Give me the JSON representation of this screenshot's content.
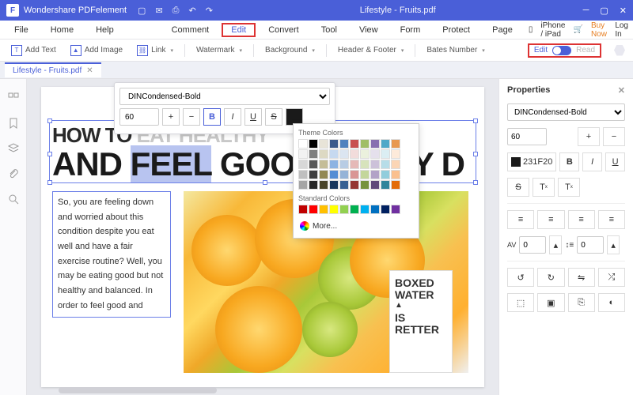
{
  "titlebar": {
    "app": "Wondershare PDFelement",
    "document": "Lifestyle - Fruits.pdf"
  },
  "menus": {
    "file": "File",
    "home": "Home",
    "help": "Help",
    "comment": "Comment",
    "edit": "Edit",
    "convert": "Convert",
    "tool": "Tool",
    "view": "View",
    "form": "Form",
    "protect": "Protect",
    "page": "Page",
    "iphone": "iPhone / iPad",
    "buy": "Buy Now",
    "login": "Log In"
  },
  "toolbar": {
    "addText": "Add Text",
    "addImage": "Add Image",
    "link": "Link",
    "watermark": "Watermark",
    "background": "Background",
    "headerFooter": "Header & Footer",
    "bates": "Bates Number",
    "edit": "Edit",
    "read": "Read"
  },
  "tab": {
    "name": "Lifestyle - Fruits.pdf"
  },
  "float": {
    "font": "DINCondensed-Bold",
    "size": "60"
  },
  "colorpop": {
    "theme": "Theme Colors",
    "standard": "Standard Colors",
    "more": "More..."
  },
  "doc": {
    "hl1a": "HOW TO ",
    "hl1b": "EAT HEALTHY",
    "hl2a": "AND ",
    "hl2b": "FEEL",
    "hl2c": " GOOD ",
    "hl2d": "RY D",
    "body": "So, you are feeling down and worried about this condition despite you eat well and have a fair exercise routine? Well, you may be eating good but not healthy and balanced.\nIn order to feel good and",
    "carton1": "BOXED",
    "carton2": "WATER",
    "carton3": "IS",
    "carton4": "RETTER"
  },
  "props": {
    "title": "Properties",
    "font": "DINCondensed-Bold",
    "size": "60",
    "color": "231F20",
    "spacing": "0",
    "leading": "0"
  }
}
